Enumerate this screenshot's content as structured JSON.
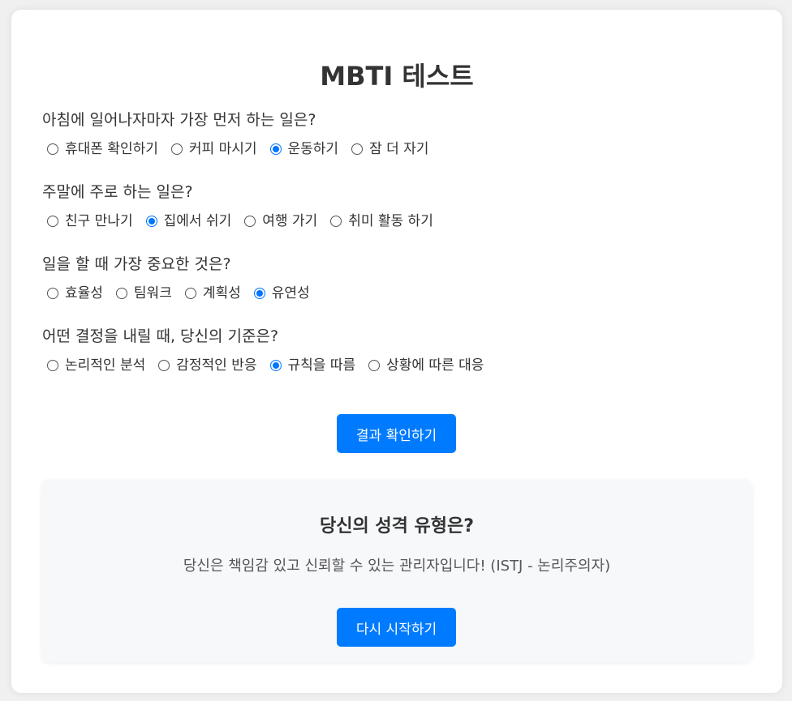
{
  "title": "MBTI 테스트",
  "questions": [
    {
      "text": "아침에 일어나자마자 가장 먼저 하는 일은?",
      "options": [
        "휴대폰 확인하기",
        "커피 마시기",
        "운동하기",
        "잠 더 자기"
      ],
      "selected": 2
    },
    {
      "text": "주말에 주로 하는 일은?",
      "options": [
        "친구 만나기",
        "집에서 쉬기",
        "여행 가기",
        "취미 활동 하기"
      ],
      "selected": 1
    },
    {
      "text": "일을 할 때 가장 중요한 것은?",
      "options": [
        "효율성",
        "팀워크",
        "계획성",
        "유연성"
      ],
      "selected": 3
    },
    {
      "text": "어떤 결정을 내릴 때, 당신의 기준은?",
      "options": [
        "논리적인 분석",
        "감정적인 반응",
        "규칙을 따름",
        "상황에 따른 대응"
      ],
      "selected": 2
    }
  ],
  "submit_label": "결과 확인하기",
  "result": {
    "title": "당신의 성격 유형은?",
    "text": "당신은 책임감 있고 신뢰할 수 있는 관리자입니다! (ISTJ - 논리주의자)",
    "restart_label": "다시 시작하기"
  },
  "colors": {
    "accent": "#007bff",
    "radio_checked": "#0075ff",
    "background": "#f0f0f0",
    "card": "#ffffff",
    "result_panel": "#f7f8fa"
  }
}
